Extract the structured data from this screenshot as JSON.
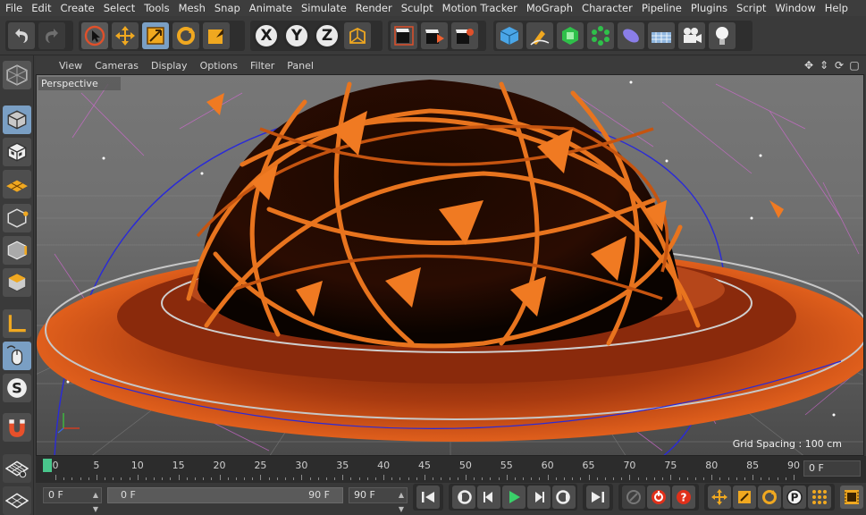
{
  "menu": [
    "File",
    "Edit",
    "Create",
    "Select",
    "Tools",
    "Mesh",
    "Snap",
    "Animate",
    "Simulate",
    "Render",
    "Sculpt",
    "Motion Tracker",
    "MoGraph",
    "Character",
    "Pipeline",
    "Plugins",
    "Script",
    "Window",
    "Help"
  ],
  "axis_buttons": [
    "X",
    "Y",
    "Z"
  ],
  "viewport_menu": [
    "View",
    "Cameras",
    "Display",
    "Options",
    "Filter",
    "Panel"
  ],
  "viewport": {
    "label": "Perspective",
    "grid_spacing": "Grid Spacing : 100 cm"
  },
  "timeline": {
    "ticks": [
      0,
      5,
      10,
      15,
      20,
      25,
      30,
      35,
      40,
      45,
      50,
      55,
      60,
      65,
      70,
      75,
      80,
      85,
      90
    ],
    "current_frame": "0 F"
  },
  "transport": {
    "start_field": "0 F",
    "range_start": "0 F",
    "range_end": "90 F",
    "end_field": "90 F"
  },
  "colors": {
    "accent_active": "#7a9fc4",
    "scene_orange": "#e05f1c",
    "timeline_cursor": "#49c68c"
  },
  "icons": {
    "toolbar": [
      "undo-icon",
      "redo-icon",
      "live-selection-icon",
      "move-icon",
      "scale-icon",
      "rotate-icon",
      "recent-tool-icon",
      "world-coordinates-icon",
      "render-view-icon",
      "render-picture-viewer-icon",
      "render-settings-icon",
      "cube-icon",
      "pen-spline-icon",
      "subdivision-icon",
      "array-icon",
      "deformer-icon",
      "floor-icon",
      "camera-icon",
      "light-icon"
    ],
    "left": [
      "make-editable-icon",
      "model-mode-icon",
      "texture-mode-icon",
      "workplane-icon",
      "points-mode-icon",
      "edges-mode-icon",
      "polygons-mode-icon",
      "axis-icon",
      "tweak-icon",
      "solo-icon",
      "magnet-icon",
      "snap-icon",
      "lock-grid-icon"
    ],
    "playback": [
      "go-to-start-icon",
      "previous-key-icon",
      "previous-frame-icon",
      "play-icon",
      "next-frame-icon",
      "next-key-icon",
      "go-to-end-icon",
      "record-keys-icon",
      "autokey-icon",
      "keyframe-selection-icon",
      "position-key-icon",
      "scale-key-icon",
      "rotation-key-icon",
      "parameter-key-icon",
      "pla-key-icon",
      "timeline-icon"
    ]
  }
}
